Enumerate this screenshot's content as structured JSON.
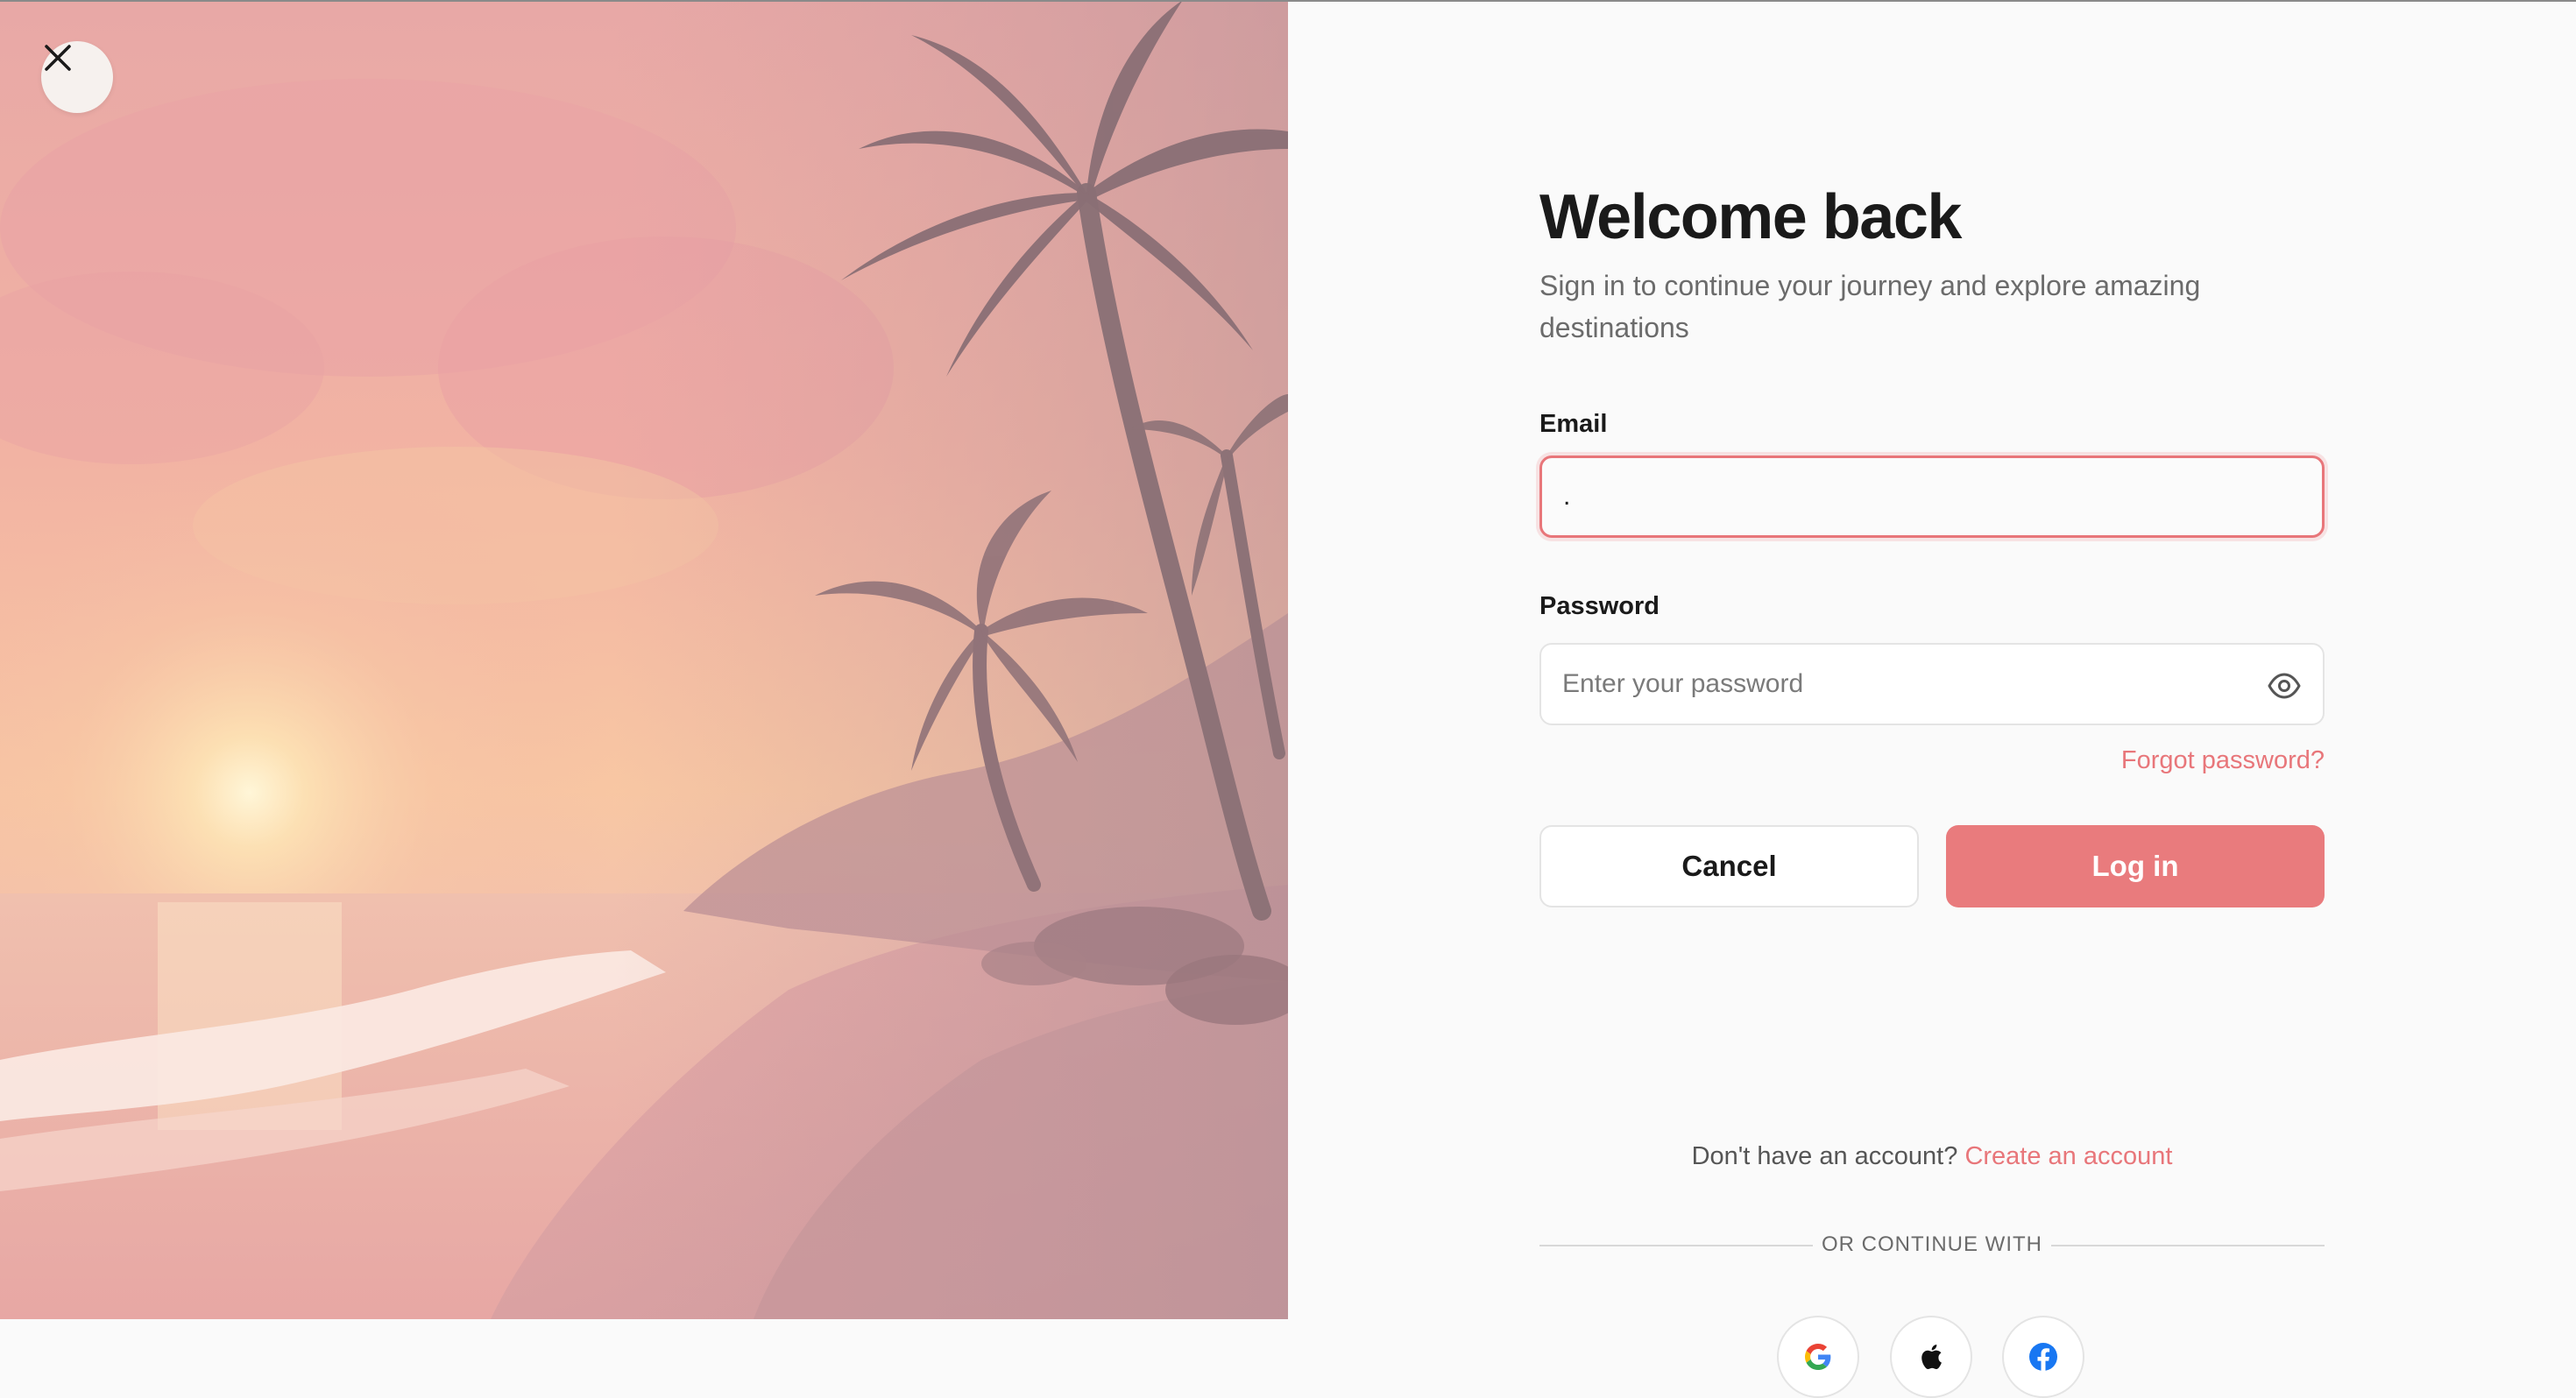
{
  "hero": {
    "close_icon": "close-icon"
  },
  "login": {
    "title": "Welcome back",
    "subtitle": "Sign in to continue your journey and explore amazing destinations",
    "email_label": "Email",
    "email_value": ".",
    "password_label": "Password",
    "password_placeholder": "Enter your password",
    "forgot_password": "Forgot password?",
    "cancel_label": "Cancel",
    "login_label": "Log in",
    "no_account_text": "Don't have an account?",
    "create_account_link": "Create an account",
    "divider_text": "OR CONTINUE WITH"
  },
  "social": [
    {
      "name": "google-icon"
    },
    {
      "name": "apple-icon"
    },
    {
      "name": "facebook-icon"
    }
  ],
  "colors": {
    "accent": "#e97b7d",
    "error_border": "#e8767a",
    "panel_bg": "#fafafa"
  }
}
